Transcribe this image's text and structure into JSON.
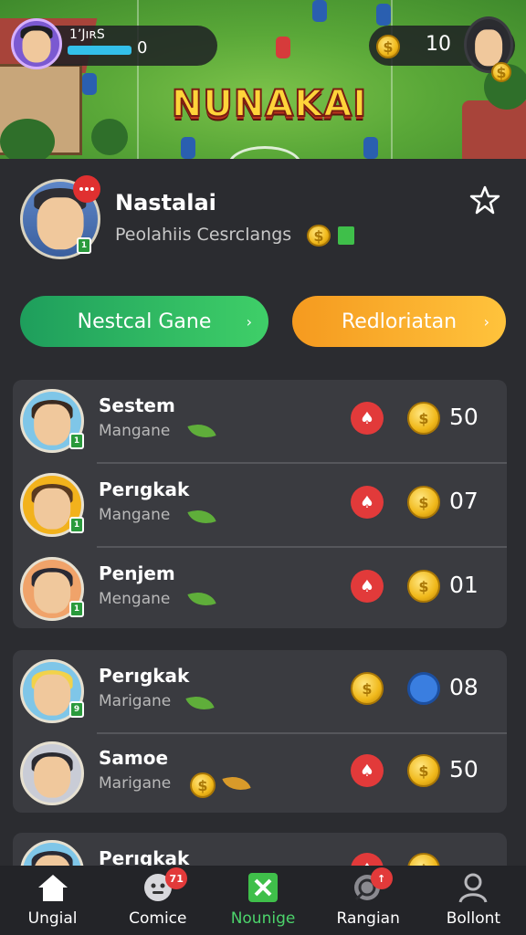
{
  "hud": {
    "player_name": "1ʼJıʀS",
    "xp_value": "0",
    "coins": "10",
    "game_logo": "NUNAKAI"
  },
  "profile": {
    "name": "Nastalai",
    "subtitle": "Peolahiis Cesrclangs",
    "level": "1"
  },
  "actions": {
    "primary": "Nestcal Gane",
    "secondary": "Redloriatan"
  },
  "group_one": [
    {
      "name": "Sestem",
      "sub": "Mangane",
      "value": "50",
      "level": "1",
      "frame": "#7fc6e8",
      "hair": "#3a2a20"
    },
    {
      "name": "Perıgkak",
      "sub": "Mangane",
      "value": "07",
      "level": "1",
      "frame": "#f2b21c",
      "hair": "#5a3a20"
    },
    {
      "name": "Penjem",
      "sub": "Mengane",
      "value": "01",
      "level": "1",
      "frame": "#f0a36a",
      "hair": "#2a2a34"
    }
  ],
  "group_two": [
    {
      "name": "Perıgkak",
      "sub": "Marigane",
      "value": "08",
      "level": "9",
      "frame": "#7fc6e8",
      "hair": "#f2d24a"
    },
    {
      "name": "Samoe",
      "sub": "Marigane",
      "value": "50",
      "level": "",
      "frame": "#c9ccd6",
      "hair": "#2a2a30"
    }
  ],
  "group_three": [
    {
      "name": "Perıgkak"
    }
  ],
  "nav": [
    {
      "label": "Ungial",
      "icon": "home-icon"
    },
    {
      "label": "Comice",
      "icon": "chat-icon",
      "badge": "71"
    },
    {
      "label": "Nounige",
      "icon": "cross-box-icon"
    },
    {
      "label": "Rangian",
      "icon": "ranking-icon"
    },
    {
      "label": "Bollont",
      "icon": "profile-icon"
    }
  ],
  "colors": {
    "accent_green": "#3fcf68",
    "accent_orange": "#ffc33c",
    "badge_red": "#e23a3a",
    "background": "#2b2c30"
  }
}
